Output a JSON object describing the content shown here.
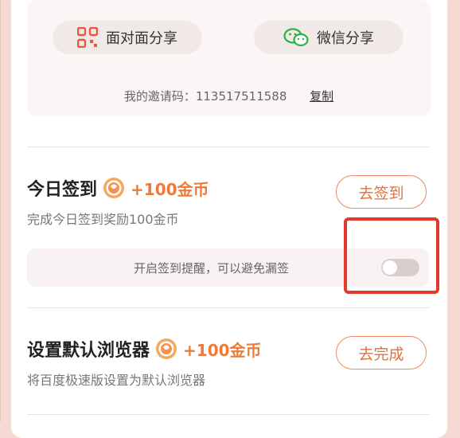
{
  "share": {
    "face_to_face_label": "面对面分享",
    "wechat_label": "微信分享",
    "invite_prefix": "我的邀请码：",
    "invite_code": "113517511588",
    "copy_label": "复制"
  },
  "tasks": [
    {
      "title": "今日签到",
      "reward": "+100金币",
      "desc": "完成今日签到奖励100金币",
      "button": "去签到",
      "reminder_text": "开启签到提醒，可以避免漏签",
      "reminder_on": false
    },
    {
      "title": "设置默认浏览器",
      "reward": "+100金币",
      "desc": "将百度极速版设置为默认浏览器",
      "button": "去完成"
    }
  ],
  "colors": {
    "accent": "#e3703d",
    "reward": "#ee7a3a",
    "highlight": "#e2392a",
    "page_bg": "#f5d9d2"
  },
  "icons": [
    "qr-code-icon",
    "wechat-icon",
    "coin-icon"
  ]
}
